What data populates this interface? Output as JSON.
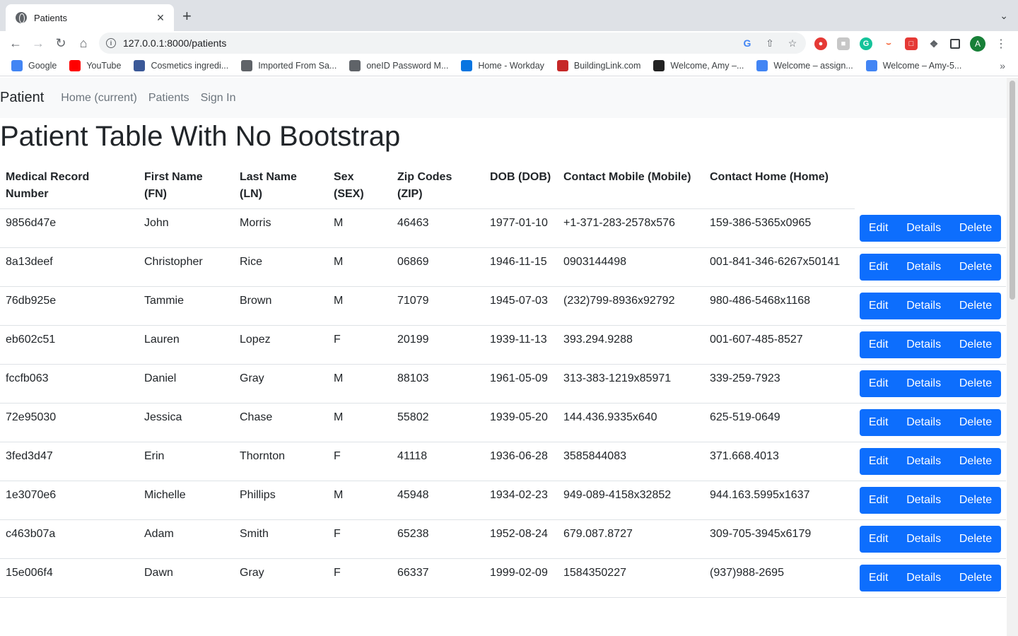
{
  "browser": {
    "tab_title": "Patients",
    "tab_close": "×",
    "new_tab": "+",
    "url": "127.0.0.1:8000/patients",
    "avatar_letter": "A",
    "bookmarks": [
      {
        "label": "Google",
        "icon": "google-icon",
        "color": "#4285f4"
      },
      {
        "label": "YouTube",
        "icon": "youtube-icon",
        "color": "#ff0000"
      },
      {
        "label": "Cosmetics ingredi...",
        "icon": "cosmetics-icon",
        "color": "#3b5998"
      },
      {
        "label": "Imported From Sa...",
        "icon": "folder-icon",
        "color": "#5f6368"
      },
      {
        "label": "oneID Password M...",
        "icon": "oneid-icon",
        "color": "#5f6368"
      },
      {
        "label": "Home - Workday",
        "icon": "workday-icon",
        "color": "#0875e1"
      },
      {
        "label": "BuildingLink.com",
        "icon": "buildinglink-icon",
        "color": "#c62828"
      },
      {
        "label": "Welcome, Amy –...",
        "icon": "blackboard-icon",
        "color": "#222222"
      },
      {
        "label": "Welcome – assign...",
        "icon": "gcloud-icon",
        "color": "#4285f4"
      },
      {
        "label": "Welcome – Amy-5...",
        "icon": "gcloud-icon",
        "color": "#4285f4"
      }
    ]
  },
  "navbar": {
    "brand": "Patient",
    "links": [
      "Home (current)",
      "Patients",
      "Sign In"
    ]
  },
  "page_title": "Patient Table With No Bootstrap",
  "table": {
    "headers": [
      "Medical Record Number",
      "First Name (FN)",
      "Last Name (LN)",
      "Sex (SEX)",
      "Zip Codes (ZIP)",
      "DOB (DOB)",
      "Contact Mobile (Mobile)",
      "Contact Home (Home)"
    ],
    "actions": {
      "edit": "Edit",
      "details": "Details",
      "delete": "Delete"
    },
    "rows": [
      [
        "9856d47e",
        "John",
        "Morris",
        "M",
        "46463",
        "1977-01-10",
        "+1-371-283-2578x576",
        "159-386-5365x0965"
      ],
      [
        "8a13deef",
        "Christopher",
        "Rice",
        "M",
        "06869",
        "1946-11-15",
        "0903144498",
        "001-841-346-6267x50141"
      ],
      [
        "76db925e",
        "Tammie",
        "Brown",
        "M",
        "71079",
        "1945-07-03",
        "(232)799-8936x92792",
        "980-486-5468x1168"
      ],
      [
        "eb602c51",
        "Lauren",
        "Lopez",
        "F",
        "20199",
        "1939-11-13",
        "393.294.9288",
        "001-607-485-8527"
      ],
      [
        "fccfb063",
        "Daniel",
        "Gray",
        "M",
        "88103",
        "1961-05-09",
        "313-383-1219x85971",
        "339-259-7923"
      ],
      [
        "72e95030",
        "Jessica",
        "Chase",
        "M",
        "55802",
        "1939-05-20",
        "144.436.9335x640",
        "625-519-0649"
      ],
      [
        "3fed3d47",
        "Erin",
        "Thornton",
        "F",
        "41118",
        "1936-06-28",
        "3585844083",
        "371.668.4013"
      ],
      [
        "1e3070e6",
        "Michelle",
        "Phillips",
        "M",
        "45948",
        "1934-02-23",
        "949-089-4158x32852",
        "944.163.5995x1637"
      ],
      [
        "c463b07a",
        "Adam",
        "Smith",
        "F",
        "65238",
        "1952-08-24",
        "679.087.8727",
        "309-705-3945x6179"
      ],
      [
        "15e006f4",
        "Dawn",
        "Gray",
        "F",
        "66337",
        "1999-02-09",
        "1584350227",
        "(937)988-2695"
      ]
    ]
  },
  "colors": {
    "button": "#0d6efd",
    "navbar_bg": "#f8f9fa",
    "nav_link": "#6c757d"
  }
}
